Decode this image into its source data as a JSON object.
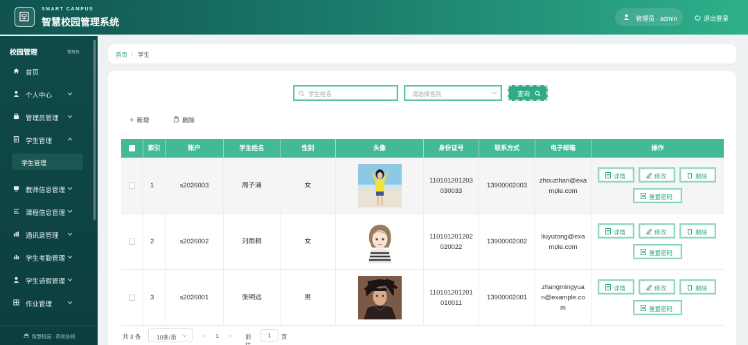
{
  "header": {
    "brand_en": "SMART CAMPUS",
    "brand_cn": "智慧校园管理系统",
    "user_label": "管理员 · admin",
    "logout_label": "退出登录"
  },
  "sidebar": {
    "title": "校园管理",
    "subtitle": "管理员",
    "items": [
      {
        "label": "首页",
        "icon": "home-icon"
      },
      {
        "label": "个人中心",
        "icon": "user-icon"
      },
      {
        "label": "管理员管理",
        "icon": "admin-icon"
      },
      {
        "label": "学生管理",
        "icon": "document-icon"
      },
      {
        "label": "教师信息管理",
        "icon": "book-icon"
      },
      {
        "label": "课程信息管理",
        "icon": "list-icon"
      },
      {
        "label": "通讯录管理",
        "icon": "chart-icon"
      },
      {
        "label": "学生考勤管理",
        "icon": "bar-chart-icon"
      },
      {
        "label": "学生请假管理",
        "icon": "user-icon"
      },
      {
        "label": "作业管理",
        "icon": "grid-icon"
      }
    ],
    "sub_item": "学生管理",
    "footer": "智慧校园 · 高效协同"
  },
  "breadcrumb": {
    "home": "首页",
    "separator": "/",
    "current": "学生"
  },
  "search": {
    "name_placeholder": "学生姓名",
    "gender_placeholder": "请选择性别",
    "query_label": "查询"
  },
  "toolbar": {
    "add_label": "新增",
    "delete_label": "删除"
  },
  "table": {
    "headers": [
      "索引",
      "账户",
      "学生姓名",
      "性别",
      "头像",
      "身份证号",
      "联系方式",
      "电子邮箱",
      "操作"
    ],
    "rows": [
      {
        "index": "1",
        "account": "s2026003",
        "name": "周子涵",
        "gender": "女",
        "id_line1": "110101201203",
        "id_line2": "030033",
        "phone": "13900002003",
        "email_line1": "zhouzihan@exa",
        "email_line2": "mple.com",
        "email_line3": ""
      },
      {
        "index": "2",
        "account": "s2026002",
        "name": "刘雨桐",
        "gender": "女",
        "id_line1": "110101201202",
        "id_line2": "020022",
        "phone": "13900002002",
        "email_line1": "liuyutong@exa",
        "email_line2": "mple.com",
        "email_line3": ""
      },
      {
        "index": "3",
        "account": "s2026001",
        "name": "张明远",
        "gender": "男",
        "id_line1": "110101201201",
        "id_line2": "010011",
        "phone": "13900002001",
        "email_line1": "zhangmingyua",
        "email_line2": "n@example.co",
        "email_line3": "m"
      }
    ],
    "actions": {
      "detail": "详情",
      "edit": "修改",
      "delete": "删除",
      "reset": "重置密码"
    }
  },
  "pagination": {
    "total": "共 3 条",
    "page_size": "10条/页",
    "prev": "<",
    "current_page": "1",
    "next": ">",
    "goto": "前往",
    "goto_value": "1",
    "page_suffix": "页"
  },
  "colors": {
    "accent": "#44b995",
    "sidebar": "#0f4a49",
    "header_start": "#10524f",
    "header_end": "#2fb08a"
  }
}
